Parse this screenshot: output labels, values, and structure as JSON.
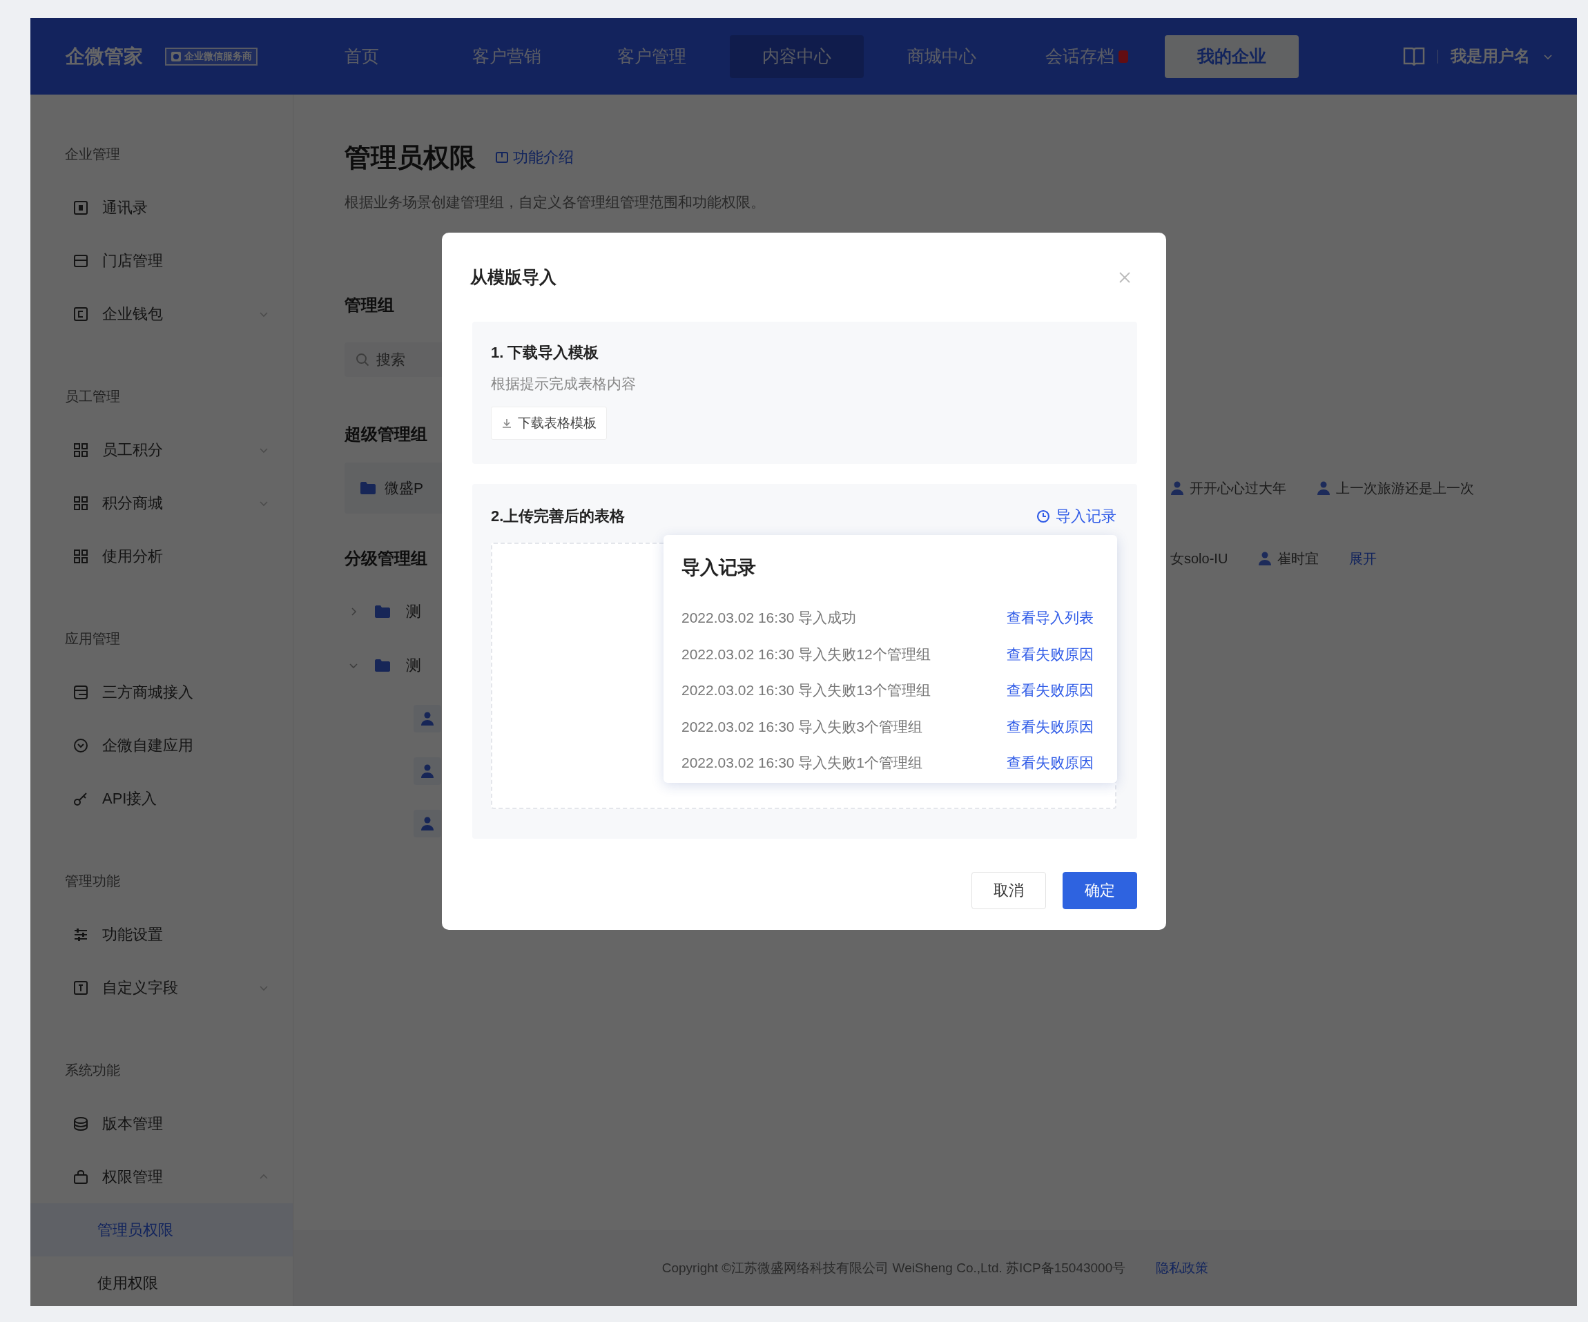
{
  "nav": {
    "logo": "企微管家",
    "logo_badge": "企业微信服务商",
    "tabs": [
      {
        "label": "首页",
        "selected": false,
        "hovered": false,
        "dot": false
      },
      {
        "label": "客户营销",
        "selected": false,
        "hovered": false,
        "dot": false
      },
      {
        "label": "客户管理",
        "selected": false,
        "hovered": false,
        "dot": false
      },
      {
        "label": "内容中心",
        "selected": false,
        "hovered": true,
        "dot": false
      },
      {
        "label": "商城中心",
        "selected": false,
        "hovered": false,
        "dot": false
      },
      {
        "label": "会话存档",
        "selected": false,
        "hovered": false,
        "dot": true
      },
      {
        "label": "我的企业",
        "selected": true,
        "hovered": false,
        "dot": false
      }
    ],
    "user": "我是用户名"
  },
  "sidebar": {
    "sections": [
      {
        "title": "企业管理",
        "items": [
          {
            "label": "通讯录",
            "kind": "link",
            "selected": false
          },
          {
            "label": "门店管理",
            "kind": "link",
            "selected": false
          },
          {
            "label": "企业钱包",
            "kind": "group",
            "expanded": false,
            "selected": false
          }
        ]
      },
      {
        "title": "员工管理",
        "items": [
          {
            "label": "员工积分",
            "kind": "group",
            "expanded": false,
            "selected": false
          },
          {
            "label": "积分商城",
            "kind": "group",
            "expanded": false,
            "selected": false
          },
          {
            "label": "使用分析",
            "kind": "link",
            "selected": false
          }
        ]
      },
      {
        "title": "应用管理",
        "items": [
          {
            "label": "三方商城接入",
            "kind": "link",
            "selected": false
          },
          {
            "label": "企微自建应用",
            "kind": "link",
            "selected": false
          },
          {
            "label": "API接入",
            "kind": "link",
            "selected": false
          }
        ]
      },
      {
        "title": "管理功能",
        "items": [
          {
            "label": "功能设置",
            "kind": "link",
            "selected": false
          },
          {
            "label": "自定义字段",
            "kind": "group",
            "expanded": false,
            "selected": false
          }
        ]
      },
      {
        "title": "系统功能",
        "items": [
          {
            "label": "版本管理",
            "kind": "link",
            "selected": false
          },
          {
            "label": "权限管理",
            "kind": "group",
            "expanded": true,
            "selected": false,
            "children": [
              {
                "label": "管理员权限",
                "selected": true
              },
              {
                "label": "使用权限",
                "selected": false
              }
            ]
          }
        ]
      }
    ]
  },
  "main": {
    "title": "管理员权限",
    "intro_link": "功能介绍",
    "description": "根据业务场景创建管理组，自定义各管理组管理范围和功能权限。",
    "groups_heading": "管理组",
    "search": {
      "placeholder": "搜索"
    },
    "super_group": {
      "heading": "超级管理组",
      "name": "微盛P",
      "members": [
        {
          "name": "开开心心过大年",
          "avatar": true
        },
        {
          "name": "上一次旅游还是上一次",
          "avatar": true
        }
      ]
    },
    "sub_groups": {
      "heading": "分级管理组",
      "members": [
        {
          "name": "女solo-IU",
          "avatar": false
        },
        {
          "name": "崔时宜",
          "avatar": true
        }
      ],
      "more_link": "展开",
      "tree": [
        {
          "label": "测",
          "expanded": false
        },
        {
          "label": "测",
          "expanded": true,
          "children": [
            {
              "kind": "member"
            },
            {
              "kind": "member"
            },
            {
              "kind": "member"
            }
          ]
        }
      ]
    }
  },
  "footer": {
    "copyright": "Copyright ©江苏微盛网络科技有限公司 WeiSheng Co.,Ltd. 苏ICP备15043000号",
    "privacy_link": "隐私政策"
  },
  "dialog": {
    "title": "从模版导入",
    "steps": [
      {
        "kind": "download",
        "title": "1. 下载导入模板",
        "description": "根据提示完成表格内容",
        "button": "下载表格模板"
      },
      {
        "kind": "upload",
        "title": "2.上传完善后的表格",
        "link": "导入记录"
      }
    ],
    "records_popover": {
      "title": "导入记录",
      "rows": [
        {
          "text": "2022.03.02 16:30 导入成功",
          "link": "查看导入列表"
        },
        {
          "text": "2022.03.02 16:30 导入失败12个管理组",
          "link": "查看失败原因"
        },
        {
          "text": "2022.03.02 16:30 导入失败13个管理组",
          "link": "查看失败原因"
        },
        {
          "text": "2022.03.02 16:30 导入失败3个管理组",
          "link": "查看失败原因"
        },
        {
          "text": "2022.03.02 16:30 导入失败1个管理组",
          "link": "查看失败原因"
        }
      ]
    },
    "buttons": [
      {
        "label": "取消",
        "kind": "secondary"
      },
      {
        "label": "确定",
        "kind": "primary"
      }
    ]
  }
}
